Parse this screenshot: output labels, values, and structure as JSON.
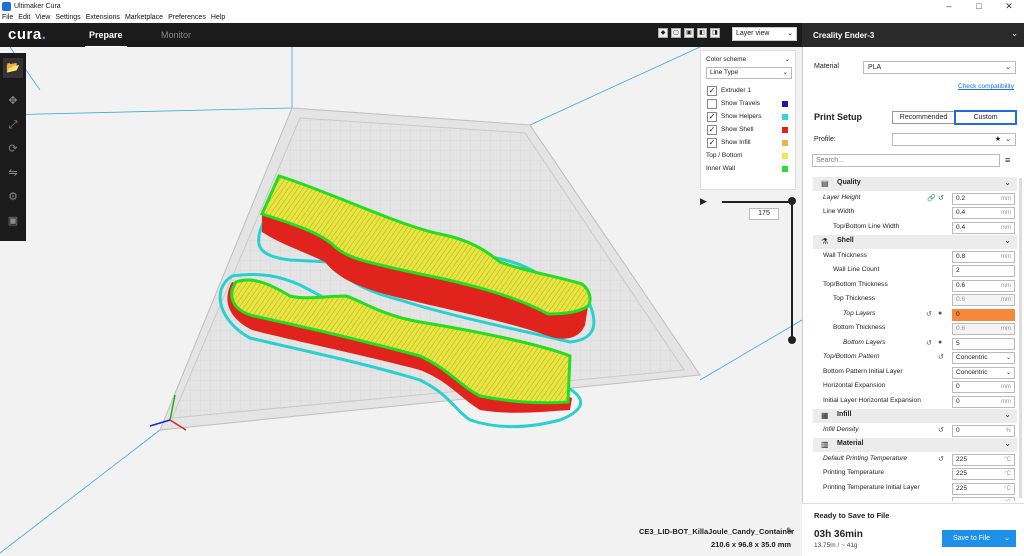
{
  "window": {
    "title": "Ultimaker Cura",
    "controls": [
      "–",
      "□",
      "✕"
    ]
  },
  "menu": [
    "File",
    "Edit",
    "View",
    "Settings",
    "Extensions",
    "Marketplace",
    "Preferences",
    "Help"
  ],
  "header": {
    "logo": "cura",
    "logo_dot": ".",
    "tabs": [
      "Prepare",
      "Monitor"
    ],
    "view_mode": "Layer view",
    "machine": "Creality Ender-3"
  },
  "left_tools": [
    {
      "icon": "open-file-icon",
      "glyph": "📂"
    },
    {
      "icon": "move-icon",
      "glyph": "✥"
    },
    {
      "icon": "scale-icon",
      "glyph": "⤢"
    },
    {
      "icon": "rotate-icon",
      "glyph": "⟳"
    },
    {
      "icon": "mirror-icon",
      "glyph": "⇋"
    },
    {
      "icon": "per-model-settings-icon",
      "glyph": "⚙"
    },
    {
      "icon": "support-blocker-icon",
      "glyph": "▣"
    }
  ],
  "color_scheme": {
    "title": "Color scheme",
    "selected": "Line Type",
    "legend": [
      {
        "label": "Extruder 1",
        "checked": true,
        "checkbox": true,
        "color": null
      },
      {
        "label": "Show Travels",
        "checked": false,
        "checkbox": true,
        "color": "#1a1aa8"
      },
      {
        "label": "Show Helpers",
        "checked": true,
        "checkbox": true,
        "color": "#33d4e0"
      },
      {
        "label": "Show Shell",
        "checked": true,
        "checkbox": true,
        "color": "#e0231c"
      },
      {
        "label": "Show Infill",
        "checked": true,
        "checkbox": true,
        "color": "#e8b84a"
      },
      {
        "label": "Top / Bottom",
        "checked": false,
        "checkbox": false,
        "color": "#f0e84a"
      },
      {
        "label": "Inner Wall",
        "checked": false,
        "checkbox": false,
        "color": "#33d93a"
      }
    ]
  },
  "layer_slider": {
    "current_layer": "175"
  },
  "model": {
    "filename": "CE3_LID-BOT_KillaJoule_Candy_Container",
    "dimensions": "210.6 x 96.8 x 35.0 mm"
  },
  "side": {
    "material_label": "Material",
    "material": "PLA",
    "compat": "Check compatibility",
    "print_setup": "Print Setup",
    "mode_recommended": "Recommended",
    "mode_custom": "Custom",
    "profile_label": "Profile:",
    "profile_value": "",
    "search_placeholder": "Search..."
  },
  "settings": [
    {
      "type": "category",
      "label": "Quality",
      "icon": "quality-icon",
      "glyph": "▤"
    },
    {
      "type": "setting",
      "label": "Layer Height",
      "value": "0.2",
      "unit": "mm",
      "indent": 0,
      "italic": true,
      "link": true,
      "reset": true
    },
    {
      "type": "setting",
      "label": "Line Width",
      "value": "0.4",
      "unit": "mm",
      "indent": 0
    },
    {
      "type": "setting",
      "label": "Top/Bottom Line Width",
      "value": "0.4",
      "unit": "mm",
      "indent": 1
    },
    {
      "type": "category",
      "label": "Shell",
      "icon": "shell-icon",
      "glyph": "⚗"
    },
    {
      "type": "setting",
      "label": "Wall Thickness",
      "value": "0.8",
      "unit": "mm",
      "indent": 0
    },
    {
      "type": "setting",
      "label": "Wall Line Count",
      "value": "2",
      "unit": "",
      "indent": 1
    },
    {
      "type": "setting",
      "label": "Top/Bottom Thickness",
      "value": "0.6",
      "unit": "mm",
      "indent": 0
    },
    {
      "type": "setting",
      "label": "Top Thickness",
      "value": "0.6",
      "unit": "mm",
      "indent": 1,
      "disabled": true
    },
    {
      "type": "setting",
      "label": "Top Layers",
      "value": "0",
      "unit": "",
      "indent": 2,
      "italic": true,
      "reset": true,
      "info": true,
      "error": true
    },
    {
      "type": "setting",
      "label": "Bottom Thickness",
      "value": "0.6",
      "unit": "mm",
      "indent": 1,
      "disabled": true
    },
    {
      "type": "setting",
      "label": "Bottom Layers",
      "value": "5",
      "unit": "",
      "indent": 2,
      "italic": true,
      "reset": true,
      "info": true
    },
    {
      "type": "setting",
      "label": "Top/Bottom Pattern",
      "value": "Concentric",
      "unit": "",
      "indent": 0,
      "italic": true,
      "reset": true,
      "select": true
    },
    {
      "type": "setting",
      "label": "Bottom Pattern Initial Layer",
      "value": "Concentric",
      "unit": "",
      "indent": 0,
      "select": true
    },
    {
      "type": "setting",
      "label": "Horizontal Expansion",
      "value": "0",
      "unit": "mm",
      "indent": 0
    },
    {
      "type": "setting",
      "label": "Initial Layer Horizontal Expansion",
      "value": "0",
      "unit": "mm",
      "indent": 0
    },
    {
      "type": "category",
      "label": "Infill",
      "icon": "infill-icon",
      "glyph": "▦"
    },
    {
      "type": "setting",
      "label": "Infill Density",
      "value": "0",
      "unit": "%",
      "indent": 0,
      "italic": true,
      "reset": true
    },
    {
      "type": "category",
      "label": "Material",
      "icon": "material-icon",
      "glyph": "▥"
    },
    {
      "type": "setting",
      "label": "Default Printing Temperature",
      "value": "225",
      "unit": "°C",
      "indent": 0,
      "italic": true,
      "reset": true
    },
    {
      "type": "setting",
      "label": "Printing Temperature",
      "value": "225",
      "unit": "°C",
      "indent": 0
    },
    {
      "type": "setting",
      "label": "Printing Temperature Initial Layer",
      "value": "225",
      "unit": "°C",
      "indent": 0
    },
    {
      "type": "setting",
      "label": "",
      "value": "",
      "unit": "°C",
      "indent": 0
    }
  ],
  "bottom": {
    "status": "Ready to Save to File",
    "time": "03h 36min",
    "material_usage": "13.75m / ~ 41g",
    "save_label": "Save to File"
  },
  "colors": {
    "shell": "#e0231c",
    "top_bottom": "#e8e440",
    "inner_wall": "#22dd22",
    "helpers": "#2ad0d0",
    "accent": "#1f90e8",
    "error": "#f5883b"
  }
}
